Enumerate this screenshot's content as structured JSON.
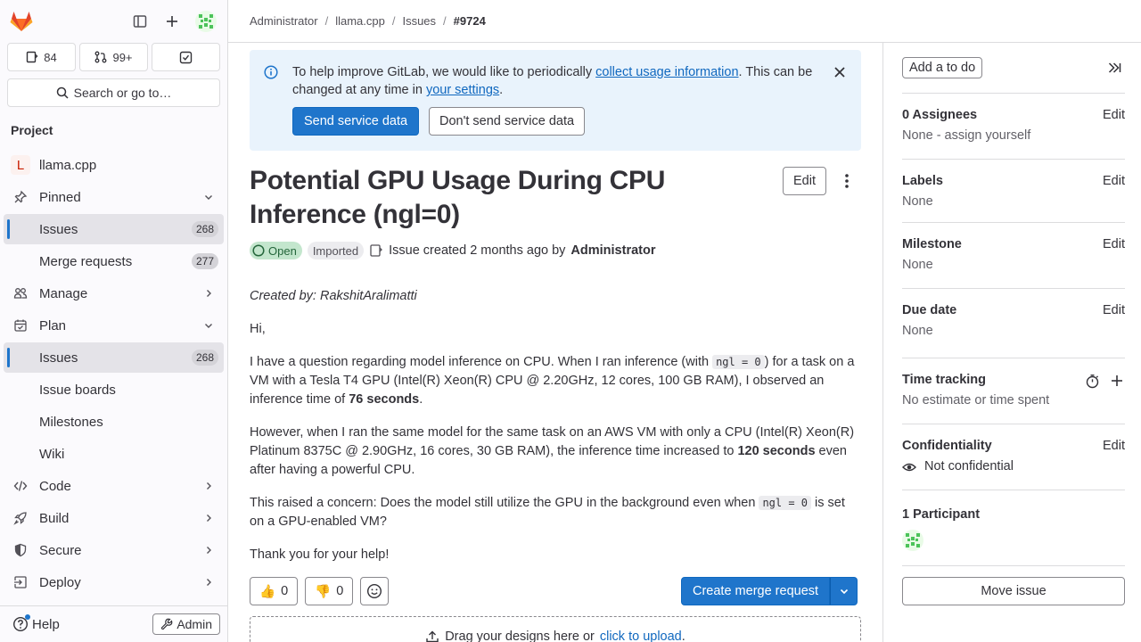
{
  "sidebar": {
    "counters": {
      "issues": "84",
      "merge_requests": "99+"
    },
    "search_label": "Search or go to…",
    "section_title": "Project",
    "project": {
      "avatar_letter": "L",
      "name": "llama.cpp"
    },
    "items": [
      {
        "label": "Pinned"
      },
      {
        "label": "Issues",
        "count": "268"
      },
      {
        "label": "Merge requests",
        "count": "277"
      },
      {
        "label": "Manage"
      },
      {
        "label": "Plan"
      },
      {
        "label": "Issues",
        "count": "268"
      },
      {
        "label": "Issue boards"
      },
      {
        "label": "Milestones"
      },
      {
        "label": "Wiki"
      },
      {
        "label": "Code"
      },
      {
        "label": "Build"
      },
      {
        "label": "Secure"
      },
      {
        "label": "Deploy"
      }
    ],
    "help_label": "Help",
    "admin_label": "Admin"
  },
  "breadcrumb": [
    "Administrator",
    "llama.cpp",
    "Issues",
    "#9724"
  ],
  "alert": {
    "text_before": "To help improve GitLab, we would like to periodically ",
    "link1": "collect usage information",
    "text_mid": ". This can be changed at any time in ",
    "link2": "your settings",
    "text_after": ".",
    "primary_btn": "Send service data",
    "secondary_btn": "Don't send service data"
  },
  "issue": {
    "title": "Potential GPU Usage During CPU Inference (ngl=0)",
    "edit_label": "Edit",
    "status": "Open",
    "imported": "Imported",
    "created_text": "Issue created 2 months ago by",
    "author": "Administrator",
    "description": {
      "created_by": "Created by: RakshitAralimatti",
      "greeting": "Hi,",
      "p1_a": "I have a question regarding model inference on CPU. When I ran inference (with ",
      "p1_code": "ngl = 0",
      "p1_b": ") for a task on a VM with a Tesla T4 GPU (Intel(R) Xeon(R) CPU @ 2.20GHz, 12 cores, 100 GB RAM), I observed an inference time of ",
      "p1_bold": "76 seconds",
      "p1_c": ".",
      "p2_a": "However, when I ran the same model for the same task on an AWS VM with only a CPU (Intel(R) Xeon(R) Platinum 8375C @ 2.90GHz, 16 cores, 30 GB RAM), the inference time increased to ",
      "p2_bold": "120 seconds",
      "p2_b": " even after having a powerful CPU.",
      "p3_a": "This raised a concern: Does the model still utilize the GPU in the background even when ",
      "p3_code": "ngl = 0",
      "p3_b": " is set on a GPU-enabled VM?",
      "thanks": "Thank you for your help!"
    },
    "thumbs_up": "0",
    "thumbs_down": "0",
    "create_mr": "Create merge request",
    "dropzone_text": "Drag your designs here or",
    "dropzone_link": "click to upload",
    "dropzone_end": "."
  },
  "right_sidebar": {
    "todo": "Add a to do",
    "assignees_title": "0 Assignees",
    "assignees_value": "None - assign yourself",
    "labels_title": "Labels",
    "labels_value": "None",
    "milestone_title": "Milestone",
    "milestone_value": "None",
    "due_title": "Due date",
    "due_value": "None",
    "time_title": "Time tracking",
    "time_value": "No estimate or time spent",
    "conf_title": "Confidentiality",
    "conf_value": "Not confidential",
    "participants_title": "1 Participant",
    "edit_label": "Edit",
    "move_issue": "Move issue"
  },
  "colors": {
    "accent": "#1f75cb",
    "status_open_bg": "#c3e6cd",
    "alert_bg": "#e9f3fc"
  }
}
